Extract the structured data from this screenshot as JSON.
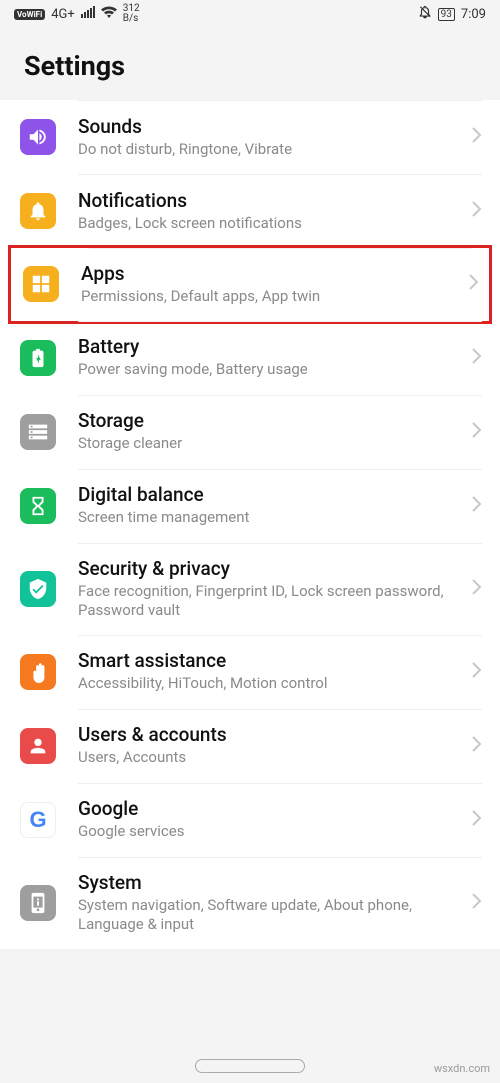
{
  "status": {
    "vowifi": "VoWiFi",
    "net": "4G+",
    "speed_top": "312",
    "speed_bot": "B/s",
    "battery": "93",
    "time": "7:09"
  },
  "header": {
    "title": "Settings"
  },
  "items": [
    {
      "id": "sounds",
      "title": "Sounds",
      "sub": "Do not disturb, Ringtone, Vibrate",
      "color": "c-purple",
      "icon": "volume"
    },
    {
      "id": "notifications",
      "title": "Notifications",
      "sub": "Badges, Lock screen notifications",
      "color": "c-gold",
      "icon": "bell"
    },
    {
      "id": "apps",
      "title": "Apps",
      "sub": "Permissions, Default apps, App twin",
      "color": "c-gold",
      "icon": "grid",
      "highlight": true
    },
    {
      "id": "battery",
      "title": "Battery",
      "sub": "Power saving mode, Battery usage",
      "color": "c-green",
      "icon": "battery"
    },
    {
      "id": "storage",
      "title": "Storage",
      "sub": "Storage cleaner",
      "color": "c-grey",
      "icon": "storage"
    },
    {
      "id": "digital",
      "title": "Digital balance",
      "sub": "Screen time management",
      "color": "c-green",
      "icon": "hourglass"
    },
    {
      "id": "security",
      "title": "Security & privacy",
      "sub": "Face recognition, Fingerprint ID, Lock screen password, Password vault",
      "color": "c-teal",
      "icon": "shield"
    },
    {
      "id": "smart",
      "title": "Smart assistance",
      "sub": "Accessibility, HiTouch, Motion control",
      "color": "c-orange",
      "icon": "hand"
    },
    {
      "id": "users",
      "title": "Users & accounts",
      "sub": "Users, Accounts",
      "color": "c-red",
      "icon": "person"
    },
    {
      "id": "google",
      "title": "Google",
      "sub": "Google services",
      "color": "c-white",
      "icon": "google"
    },
    {
      "id": "system",
      "title": "System",
      "sub": "System navigation, Software update, About phone, Language & input",
      "color": "c-grey",
      "icon": "system"
    }
  ],
  "watermark": "wsxdn.com"
}
